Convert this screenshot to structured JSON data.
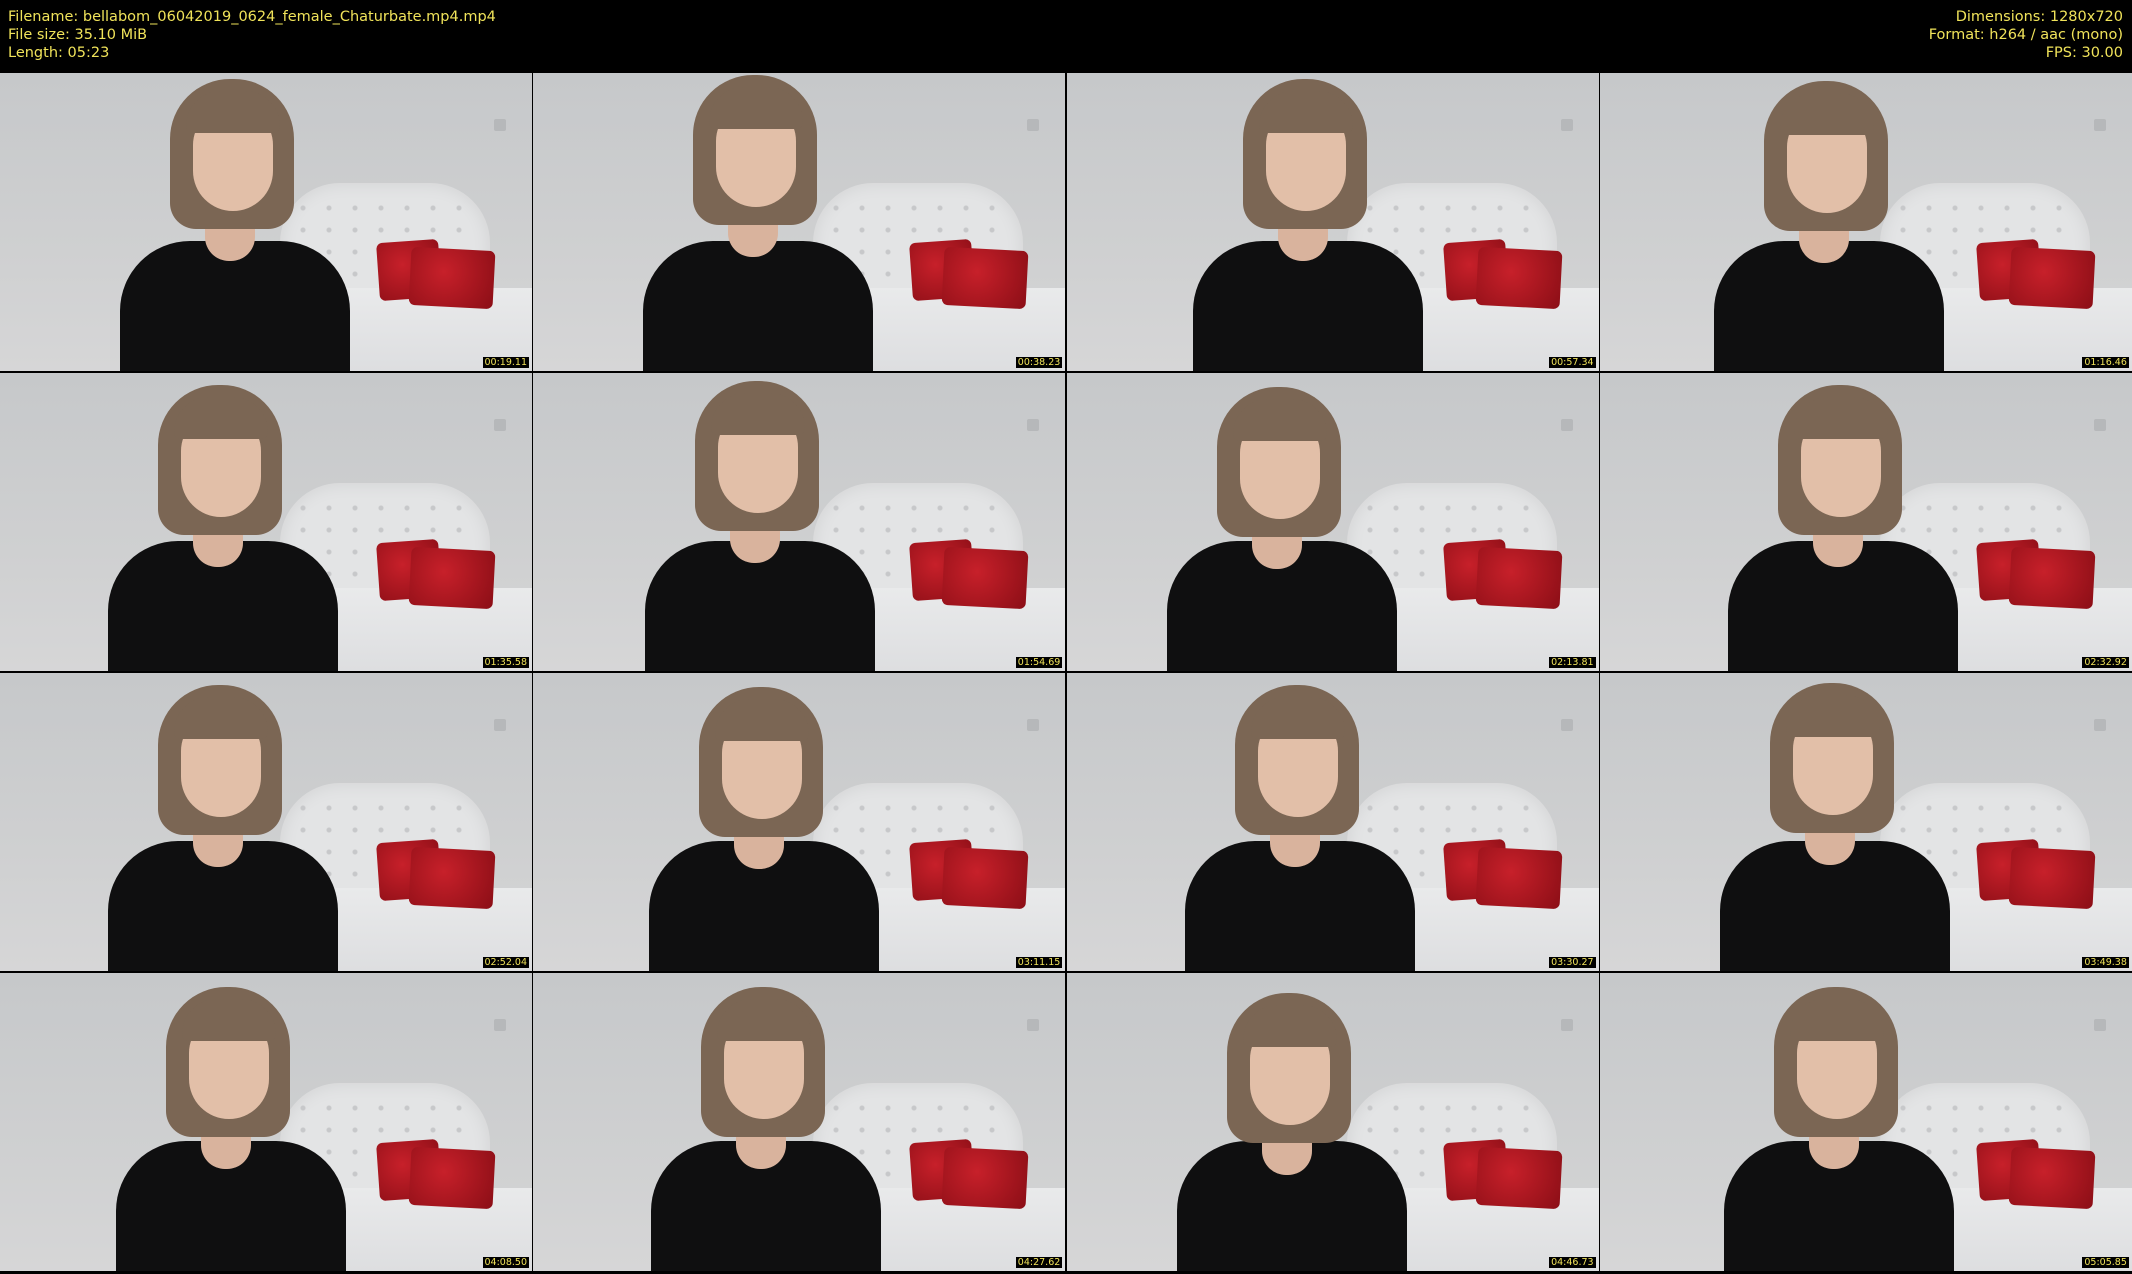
{
  "header": {
    "filename": "Filename: bellabom_06042019_0624_female_Chaturbate.mp4.mp4",
    "filesize": "File size: 35.10 MiB",
    "length": "Length: 05:23",
    "dimensions": "Dimensions: 1280x720",
    "format": "Format: h264 / aac (mono)",
    "fps": "FPS: 30.00"
  },
  "thumbnails": [
    {
      "timestamp": "00:19.11"
    },
    {
      "timestamp": "00:38.23"
    },
    {
      "timestamp": "00:57.34"
    },
    {
      "timestamp": "01:16.46"
    },
    {
      "timestamp": "01:35.58"
    },
    {
      "timestamp": "01:54.69"
    },
    {
      "timestamp": "02:13.81"
    },
    {
      "timestamp": "02:32.92"
    },
    {
      "timestamp": "02:52.04"
    },
    {
      "timestamp": "03:11.15"
    },
    {
      "timestamp": "03:30.27"
    },
    {
      "timestamp": "03:49.38"
    },
    {
      "timestamp": "04:08.50"
    },
    {
      "timestamp": "04:27.62"
    },
    {
      "timestamp": "04:46.73"
    },
    {
      "timestamp": "05:05.85"
    }
  ],
  "colors": {
    "background": "#000000",
    "text": "#f0e35a",
    "shirt": "#0f0f10",
    "pillow": "#b3141e"
  }
}
